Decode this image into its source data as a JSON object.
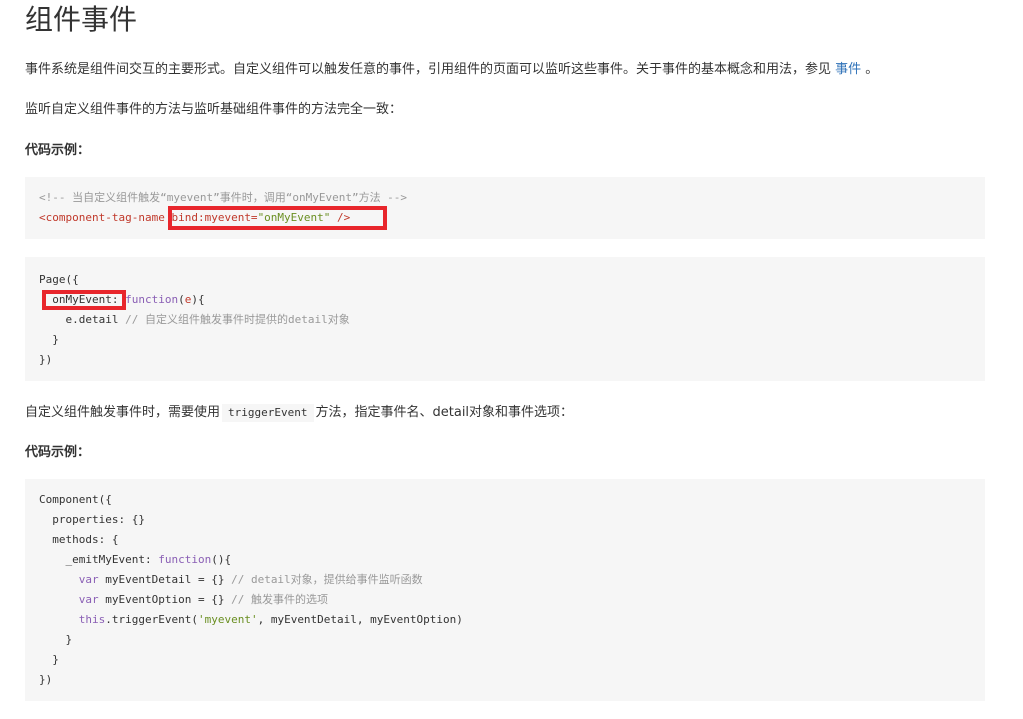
{
  "title": "组件事件",
  "intro": {
    "text_before_link": "事件系统是组件间交互的主要形式。自定义组件可以触发任意的事件，引用组件的页面可以监听这些事件。关于事件的基本概念和用法，参见 ",
    "link_text": "事件",
    "text_after_link": " 。"
  },
  "para2": "监听自定义组件事件的方法与监听基础组件事件的方法完全一致：",
  "code_example_label_1": "代码示例：",
  "code1": {
    "comment": "<!-- 当自定义组件触发“myevent”事件时，调用“onMyEvent”方法 -->",
    "tag_open": "<component-tag-name",
    "attr": " bind:myevent=",
    "value": "\"onMyEvent\"",
    "tag_close": " />"
  },
  "code2": {
    "line1": "Page({",
    "method_name": "onMyEvent:",
    "keyword": "function",
    "param_open": "(",
    "param": "e",
    "param_close": "){",
    "line3_code": "e.detail",
    "line3_comment": " // 自定义组件触发事件时提供的detail对象",
    "line4": "}",
    "line5": "})"
  },
  "para3": {
    "before": "自定义组件触发事件时，需要使用",
    "code": "triggerEvent",
    "after": "方法，指定事件名、detail对象和事件选项："
  },
  "code_example_label_2": "代码示例：",
  "code3": {
    "l1": "Component({",
    "l2": "properties: {}",
    "l3": "methods: {",
    "l4_name": "_emitMyEvent: ",
    "l4_kw": "function",
    "l4_rest": "(){",
    "l5_kw": "var",
    "l5_code": " myEventDetail = {} ",
    "l5_comment": "// detail对象，提供给事件监听函数",
    "l6_kw": "var",
    "l6_code": " myEventOption = {} ",
    "l6_comment": "// 触发事件的选项",
    "l7_kw": "this",
    "l7_code_a": ".triggerEvent(",
    "l7_str": "'myevent'",
    "l7_code_b": ", myEventDetail, myEventOption)",
    "l8": "}",
    "l9": "}",
    "l10": "})"
  },
  "colors": {
    "highlight": "#e8262c",
    "link": "#2f72b8",
    "code_bg": "#f6f6f6"
  }
}
